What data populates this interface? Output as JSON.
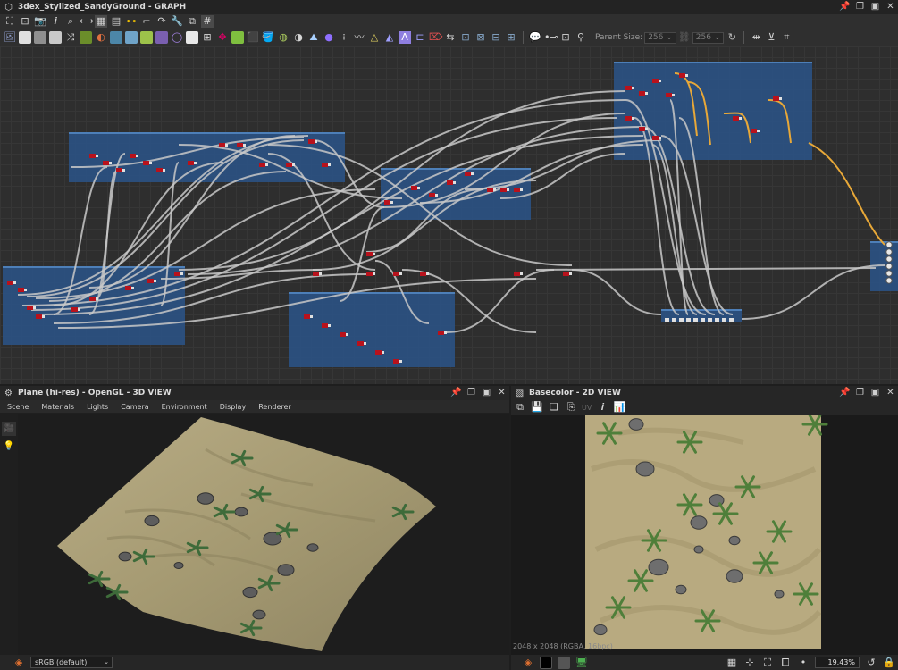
{
  "graph": {
    "title": "3dex_Stylized_SandyGround - GRAPH",
    "parent_size_label": "Parent Size:",
    "parent_size_value": "256",
    "size_value": "256"
  },
  "view3d": {
    "title": "Plane (hi-res) - OpenGL - 3D VIEW",
    "menu": [
      "Scene",
      "Materials",
      "Lights",
      "Camera",
      "Environment",
      "Display",
      "Renderer"
    ],
    "colorspace": "sRGB (default)"
  },
  "view2d": {
    "title": "Basecolor - 2D VIEW",
    "uv_label": "UV",
    "resolution": "2048 x 2048 (RGBA, 16bpc)",
    "zoom": "19.43%"
  },
  "colors": {
    "frame_blue": "#2b568c",
    "node_red": "#b8121c",
    "wire": "#c8c8c8",
    "wire_orange": "#e8a838",
    "sand": "#b3a67f"
  }
}
